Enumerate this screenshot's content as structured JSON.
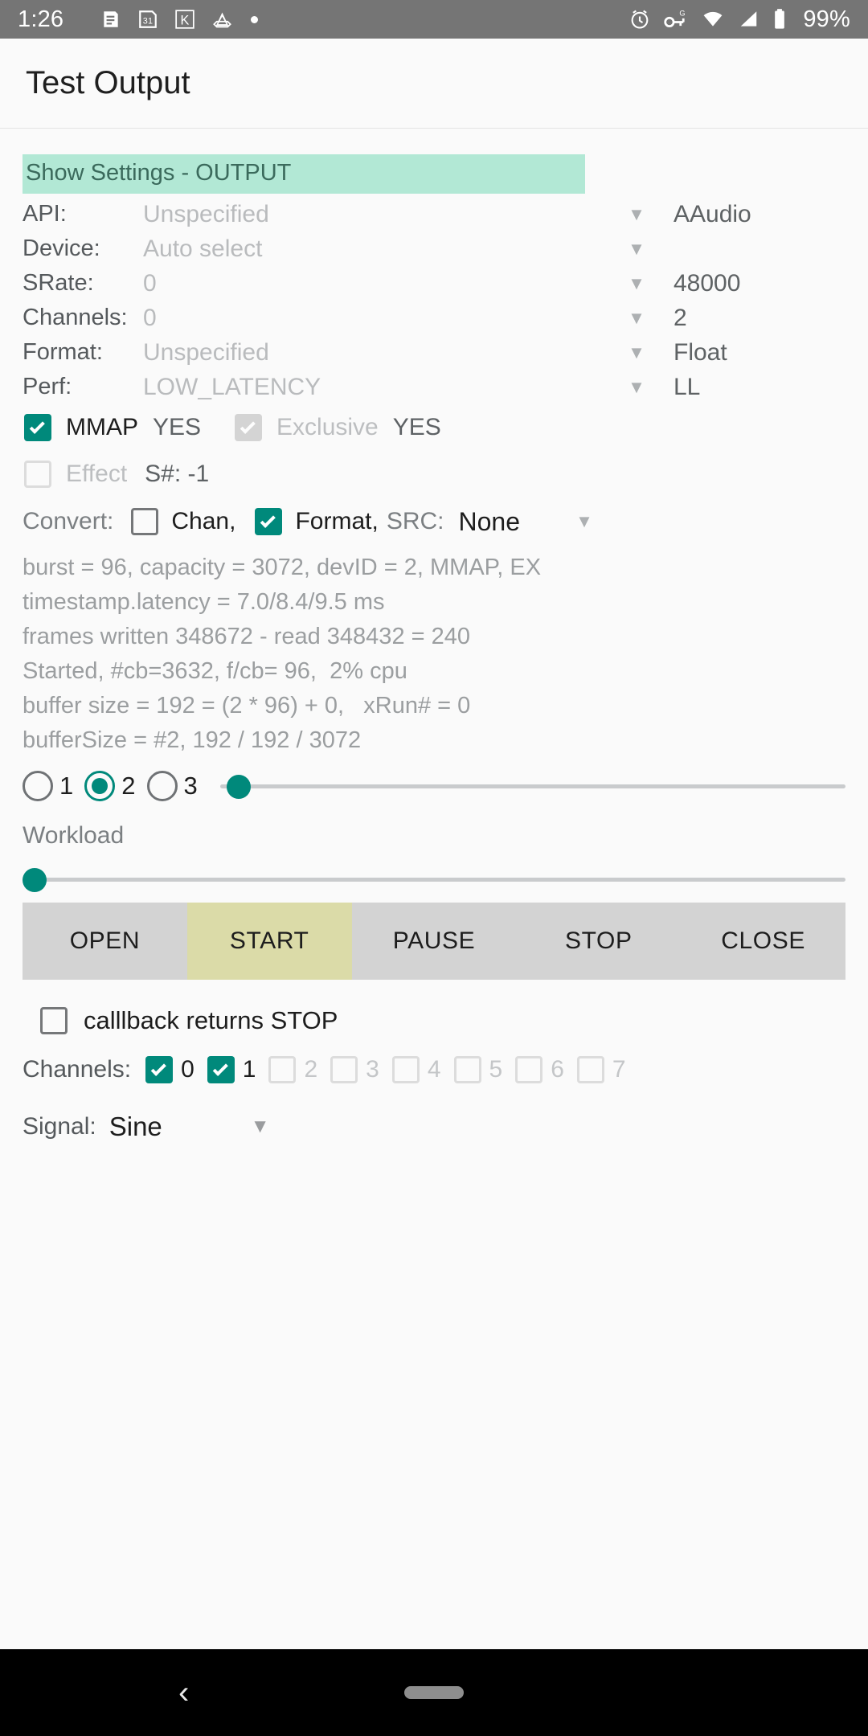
{
  "statusbar": {
    "time": "1:26",
    "left_icons": [
      "news-icon",
      "calendar-31-icon",
      "kotlin-k-icon",
      "drive-triangle-icon",
      "dot-icon"
    ],
    "right_icons": [
      "alarm-icon",
      "vpn-key-g-icon",
      "wifi-icon",
      "signal-icon",
      "battery-icon"
    ],
    "battery": "99%"
  },
  "appbar": {
    "title": "Test Output"
  },
  "banner": {
    "label": "Show Settings - OUTPUT"
  },
  "settings": {
    "rows": [
      {
        "label": "API:",
        "value": "Unspecified",
        "caret": "▼",
        "actual": "AAudio"
      },
      {
        "label": "Device:",
        "value": "Auto select",
        "caret": "▼",
        "actual": ""
      },
      {
        "label": "SRate:",
        "value": "0",
        "caret": "▼",
        "actual": "48000"
      },
      {
        "label": "Channels:",
        "value": "0",
        "caret": "▼",
        "actual": "2"
      },
      {
        "label": "Format:",
        "value": "Unspecified",
        "caret": "▼",
        "actual": "Float"
      },
      {
        "label": "Perf:",
        "value": "LOW_LATENCY",
        "caret": "▼",
        "actual": "LL"
      }
    ]
  },
  "mmap": {
    "mmap_label": "MMAP",
    "mmap_value": "YES",
    "mmap_checked": true,
    "exclusive_label": "Exclusive",
    "exclusive_value": "YES",
    "exclusive_checked": true,
    "exclusive_enabled": false
  },
  "effect": {
    "label": "Effect",
    "session": "S#: -1",
    "checked": false,
    "enabled": false
  },
  "convert": {
    "prefix": "Convert:",
    "chan_label": "Chan,",
    "chan_checked": false,
    "format_label": "Format,",
    "format_checked": true,
    "src_label": "SRC:",
    "src_value": "None",
    "caret": "▼"
  },
  "status_lines": [
    "burst = 96, capacity = 3072, devID = 2, MMAP, EX",
    "timestamp.latency = 7.0/8.4/9.5 ms",
    "frames written 348672 - read 348432 = 240",
    "Started, #cb=3632, f/cb= 96,  2% cpu",
    "buffer size = 192 = (2 * 96) + 0,   xRun# = 0",
    "bufferSize = #2, 192 / 192 / 3072"
  ],
  "buffer_radio": {
    "options": [
      "1",
      "2",
      "3"
    ],
    "selected_index": 1,
    "slider_percent": 1
  },
  "workload": {
    "label": "Workload",
    "slider_percent": 0
  },
  "transport": {
    "buttons": [
      {
        "label": "OPEN",
        "highlighted": false
      },
      {
        "label": "START",
        "highlighted": true
      },
      {
        "label": "PAUSE",
        "highlighted": false
      },
      {
        "label": "STOP",
        "highlighted": false
      },
      {
        "label": "CLOSE",
        "highlighted": false
      }
    ]
  },
  "callback_stop": {
    "label": "calllback returns STOP",
    "checked": false
  },
  "channels": {
    "label": "Channels:",
    "items": [
      {
        "n": "0",
        "checked": true,
        "enabled": true
      },
      {
        "n": "1",
        "checked": true,
        "enabled": true
      },
      {
        "n": "2",
        "checked": false,
        "enabled": false
      },
      {
        "n": "3",
        "checked": false,
        "enabled": false
      },
      {
        "n": "4",
        "checked": false,
        "enabled": false
      },
      {
        "n": "5",
        "checked": false,
        "enabled": false
      },
      {
        "n": "6",
        "checked": false,
        "enabled": false
      },
      {
        "n": "7",
        "checked": false,
        "enabled": false
      }
    ]
  },
  "signal": {
    "label": "Signal:",
    "value": "Sine",
    "caret": "▼"
  },
  "navbar": {
    "back": "‹",
    "home_pill": "home-pill"
  },
  "colors": {
    "accent": "#00897b",
    "banner_bg": "#b2e8d5",
    "highlight_btn": "#dbdba8",
    "btnbar_bg": "#d3d3d3",
    "statusbar_bg": "#757575"
  }
}
